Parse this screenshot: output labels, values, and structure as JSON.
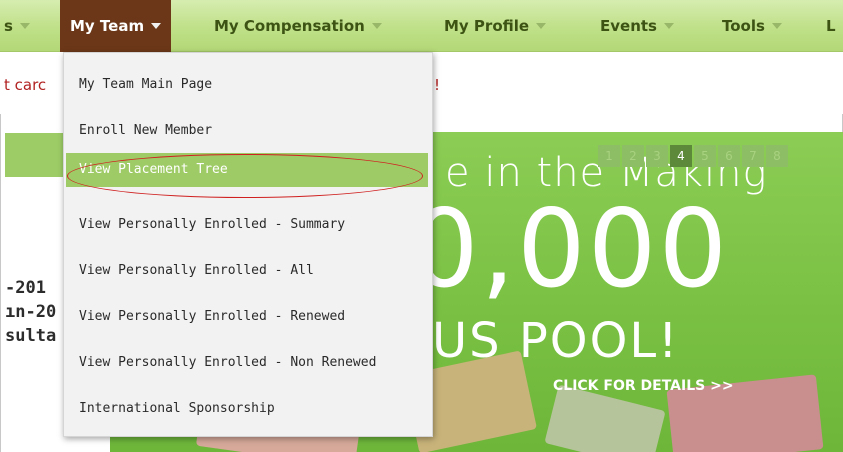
{
  "nav": {
    "items": [
      {
        "label": "s",
        "active": false
      },
      {
        "label": "My Team",
        "active": true
      },
      {
        "label": "My Compensation",
        "active": false
      },
      {
        "label": "My Profile",
        "active": false
      },
      {
        "label": "Events",
        "active": false
      },
      {
        "label": "Tools",
        "active": false
      },
      {
        "label": "L",
        "active": false
      }
    ]
  },
  "notice": {
    "left_fragment": "t carc",
    "right_fragment": "!"
  },
  "left_column": {
    "lines": [
      "-201",
      "ın-20",
      "sulta"
    ]
  },
  "dropdown": {
    "items": [
      "My Team Main Page",
      "Enroll New Member",
      "View Placement Tree",
      "View Personally Enrolled - Summary",
      "View Personally Enrolled - All",
      "View Personally Enrolled - Renewed",
      "View Personally Enrolled - Non Renewed",
      "International Sponsorship"
    ],
    "highlighted_index": 2
  },
  "banner": {
    "line1": "e in the Making",
    "big": "0,000",
    "pool": "US POOL!",
    "cta": "CLICK FOR DETAILS >>",
    "pager": [
      "1",
      "2",
      "3",
      "4",
      "5",
      "6",
      "7",
      "8"
    ],
    "pager_current": "4"
  },
  "colors": {
    "nav_bg": "#bfe088",
    "nav_active": "#6b3718",
    "banner_green": "#7ac143",
    "highlight": "#9fcb66",
    "notice_red": "#b22222",
    "ellipse_red": "#d02020"
  }
}
